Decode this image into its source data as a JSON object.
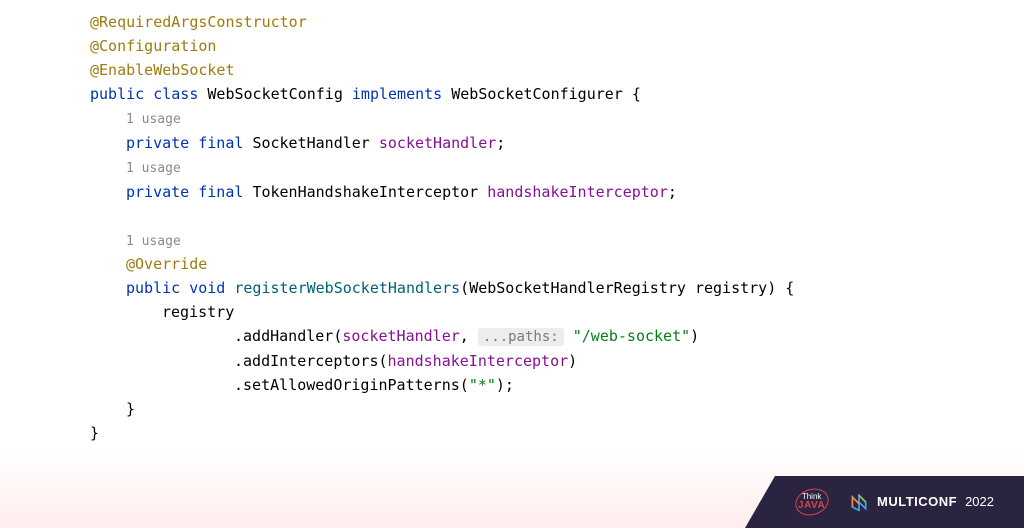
{
  "code": {
    "ann1": "@RequiredArgsConstructor",
    "ann2": "@Configuration",
    "ann3": "@EnableWebSocket",
    "kw_public": "public",
    "kw_class": "class",
    "className": "WebSocketConfig",
    "kw_implements": "implements",
    "iface": "WebSocketConfigurer",
    "brace_open": " {",
    "usage": "1 usage",
    "kw_private": "private",
    "kw_final": "final",
    "type1": "SocketHandler",
    "field1": "socketHandler",
    "semi": ";",
    "type2": "TokenHandshakeInterceptor",
    "field2": "handshakeInterceptor",
    "ann4": "@Override",
    "kw_void": "void",
    "method": "registerWebSocketHandlers",
    "paren_open": "(",
    "paramType": "WebSocketHandlerRegistry",
    "paramName": "registry",
    "paren_close_brace": ") {",
    "reg": "registry",
    "dot": ".",
    "addHandler": "addHandler",
    "arg1": "socketHandler",
    "comma": ", ",
    "inlay": "...paths:",
    "str1": "\"/web-socket\"",
    "paren_close": ")",
    "addInterceptors": "addInterceptors",
    "arg2": "handshakeInterceptor",
    "setAllowed": "setAllowedOriginPatterns",
    "str2": "\"*\"",
    "paren_close_semi": ");",
    "brace_close": "}"
  },
  "footer": {
    "think": "Think",
    "java": "JAVA",
    "multiconf": "MULTICONF",
    "year": "2022"
  }
}
